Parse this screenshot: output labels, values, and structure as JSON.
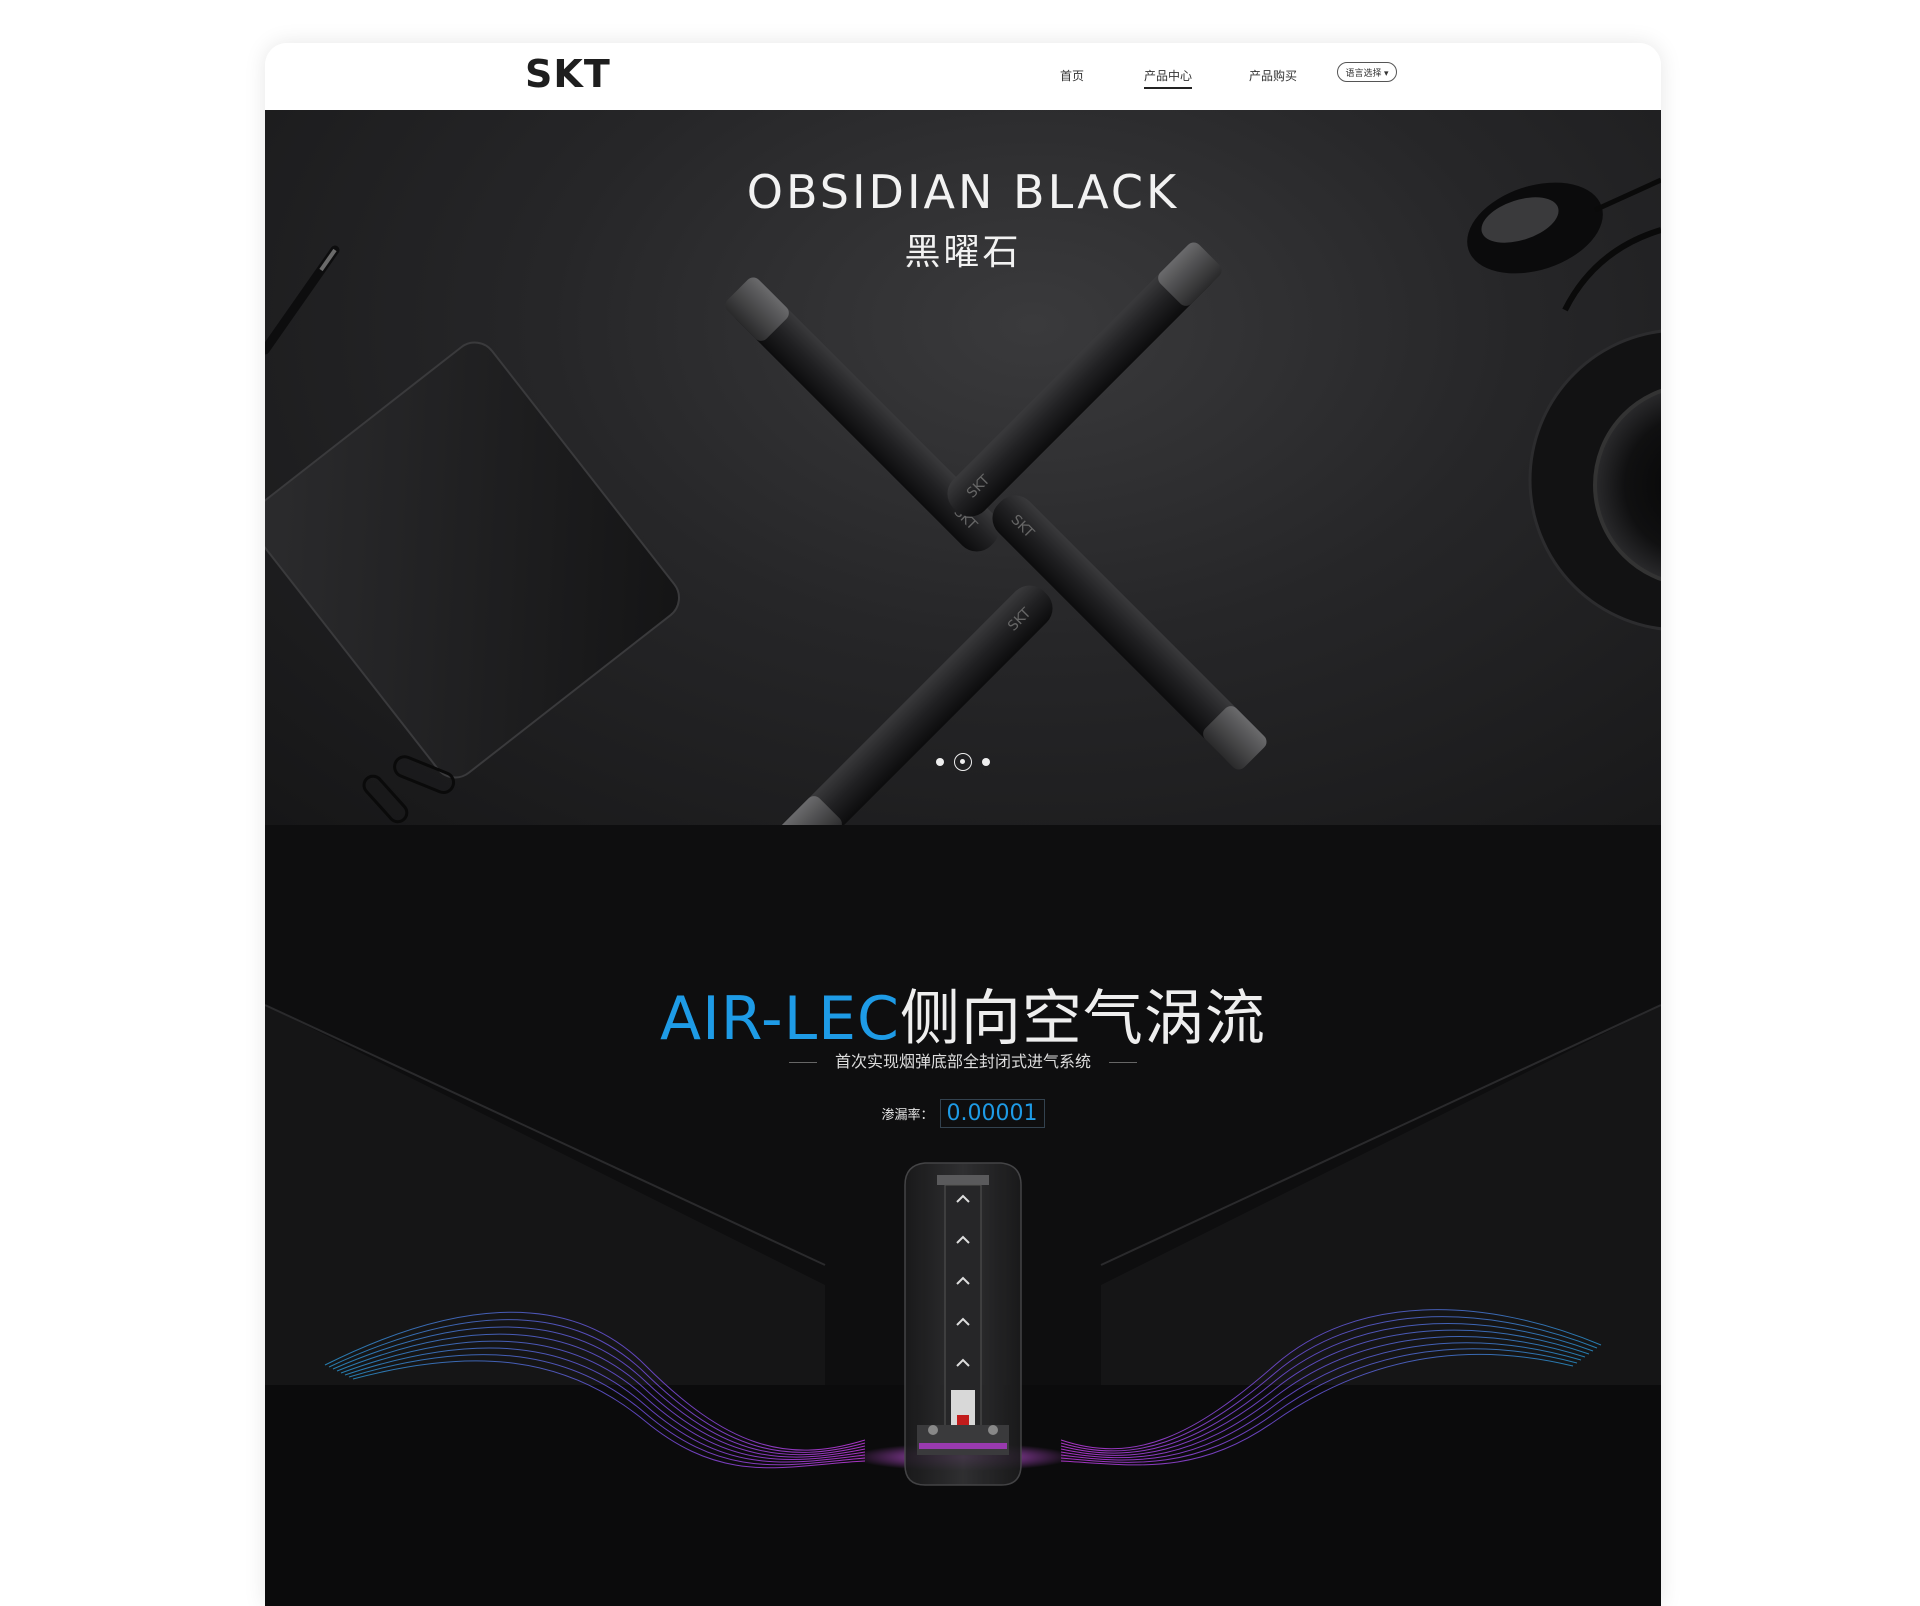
{
  "header": {
    "logo": "SKT",
    "nav": [
      {
        "label": "首页",
        "active": false
      },
      {
        "label": "产品中心",
        "active": true
      },
      {
        "label": "产品购买",
        "active": false
      }
    ],
    "language_button": "语言选择"
  },
  "hero": {
    "title": "OBSIDIAN BLACK",
    "subtitle": "黑曜石",
    "device_engraving": "SKT",
    "carousel": {
      "total": 3,
      "active": 2
    }
  },
  "feature": {
    "title_accent": "AIR-LEC",
    "title_rest": "侧向空气涡流",
    "subtitle": "首次实现烟弹底部全封闭式进气系统",
    "leak_label": "渗漏率：",
    "leak_value": "0.00001"
  },
  "colors": {
    "accent": "#1e9be6",
    "hero_background": "#262628",
    "feature_background": "#0e0e0f",
    "wave_start": "#2a8fc9",
    "wave_end": "#c23be0"
  }
}
